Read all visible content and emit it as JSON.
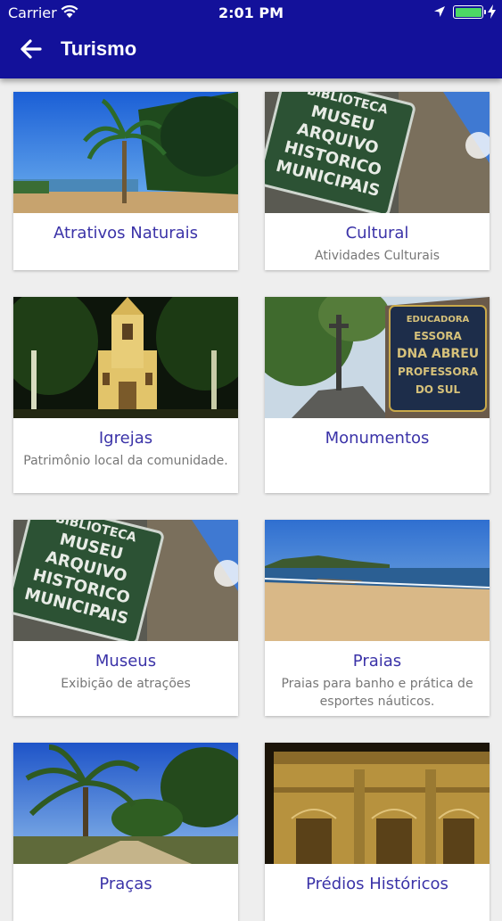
{
  "status_bar": {
    "carrier": "Carrier",
    "time": "2:01 PM"
  },
  "header": {
    "title": "Turismo"
  },
  "cards": [
    {
      "title": "Atrativos Naturais",
      "subtitle": ""
    },
    {
      "title": "Cultural",
      "subtitle": "Atividades Culturais"
    },
    {
      "title": "Igrejas",
      "subtitle": "Patrimônio local da comunidade."
    },
    {
      "title": "Monumentos",
      "subtitle": ""
    },
    {
      "title": "Museus",
      "subtitle": "Exibição de atrações"
    },
    {
      "title": "Praias",
      "subtitle": "Praias para banho e prática de esportes náuticos."
    },
    {
      "title": "Praças",
      "subtitle": ""
    },
    {
      "title": "Prédios Históricos",
      "subtitle": ""
    }
  ],
  "signs": {
    "museum": [
      "BIBLIOTECA",
      "MUSEU",
      "ARQUIVO",
      "HISTORICO",
      "MUNICIPAIS"
    ],
    "monument": [
      "EDUCADORA",
      "ESSORA",
      "DNA ABREU",
      "PROFESSORA",
      "DO SUL"
    ]
  },
  "colors": {
    "appbar": "#13119a",
    "card_title": "#3b33a8",
    "battery": "#4cd964"
  }
}
